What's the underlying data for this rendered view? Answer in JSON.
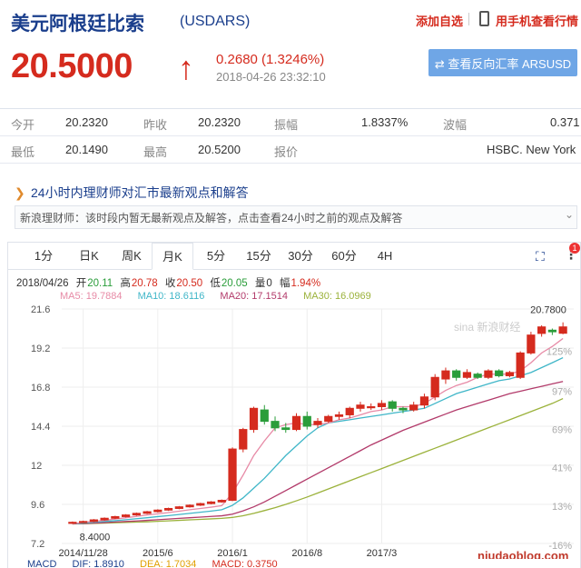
{
  "header": {
    "title": "美元阿根廷比索",
    "code": "(USDARS)",
    "add_favorite": "添加自选",
    "phone_view": "用手机查看行情"
  },
  "quote": {
    "price": "20.5000",
    "arrow": "↑",
    "change": "0.2680 (1.3246%)",
    "timestamp": "2018-04-26 23:32:10",
    "inverse_button": "⇄ 查看反向汇率 ARSUSD"
  },
  "stats": [
    [
      {
        "label": "今开",
        "value": "20.2320"
      },
      {
        "label": "昨收",
        "value": "20.2320"
      },
      {
        "label": "振幅",
        "value": "1.8337%"
      },
      {
        "label": "波幅",
        "value": "0.371"
      }
    ],
    [
      {
        "label": "最低",
        "value": "20.1490"
      },
      {
        "label": "最高",
        "value": "20.5200"
      },
      {
        "label": "报价",
        "value": ""
      },
      {
        "label": "",
        "value": "HSBC. New York"
      }
    ]
  ],
  "expert": {
    "title": "24小时内理财师对汇市最新观点和解答",
    "text": "新浪理财师：该时段内暂无最新观点及解答，点击查看24小时之前的观点及解答"
  },
  "tabs": [
    "1分",
    "日K",
    "周K",
    "月K",
    "5分",
    "15分",
    "30分",
    "60分",
    "4H"
  ],
  "active_tab": "月K",
  "badge": "1",
  "ohlc": {
    "date": "2018/04/26",
    "open_label": "开",
    "open": "20.11",
    "high_label": "高",
    "high": "20.78",
    "close_label": "收",
    "close": "20.50",
    "low_label": "低",
    "low": "20.05",
    "vol_label": "量",
    "vol": "0",
    "amp_label": "幅",
    "amp": "1.94%"
  },
  "ma": [
    {
      "label": "MA5: 19.7884",
      "color": "#e78aa6"
    },
    {
      "label": "MA10: 18.6116",
      "color": "#3fb6c8"
    },
    {
      "label": "MA20: 17.1514",
      "color": "#b23a6a"
    },
    {
      "label": "MA30: 16.0969",
      "color": "#9bb23b"
    }
  ],
  "macd": [
    {
      "label": "MACD",
      "color": "#1a3e8c"
    },
    {
      "label": "DIF: 1.8910",
      "color": "#1a3e8c"
    },
    {
      "label": "DEA: 1.7034",
      "color": "#e0a000"
    },
    {
      "label": "MACD: 0.3750",
      "color": "#d52b1e"
    }
  ],
  "watermark": "sina 新浪财经",
  "site_watermark": "niudaoblog.com",
  "colors": {
    "up": "#d52b1e",
    "down": "#2a9d3a",
    "accent": "#1a3e8c"
  },
  "chart_data": {
    "type": "candlestick",
    "y_ticks": [
      "21.6",
      "19.2",
      "16.8",
      "14.4",
      "12",
      "9.6",
      "7.2"
    ],
    "y_tick_values": [
      21.6,
      19.2,
      16.8,
      14.4,
      12,
      9.6,
      7.2
    ],
    "pct_ticks": [
      {
        "label": "125%",
        "value": 19.0
      },
      {
        "label": "97%",
        "value": 16.55
      },
      {
        "label": "69%",
        "value": 14.2
      },
      {
        "label": "41%",
        "value": 11.85
      },
      {
        "label": "13%",
        "value": 9.5
      },
      {
        "label": "-16%",
        "value": 7.1
      }
    ],
    "x_ticks": [
      "2014/11/28",
      "2015/6",
      "2016/1",
      "2016/8",
      "2017/3"
    ],
    "x_tick_index": [
      1,
      8,
      15,
      22,
      29
    ],
    "ylim": [
      7.2,
      21.6
    ],
    "max_label": "20.7800",
    "min_label": "8.4000",
    "candles": [
      [
        8.45,
        8.5,
        8.4,
        8.55
      ],
      [
        8.5,
        8.55,
        8.45,
        8.6
      ],
      [
        8.55,
        8.65,
        8.5,
        8.7
      ],
      [
        8.65,
        8.75,
        8.6,
        8.8
      ],
      [
        8.75,
        8.85,
        8.7,
        8.9
      ],
      [
        8.85,
        8.95,
        8.8,
        9.0
      ],
      [
        8.95,
        9.05,
        8.9,
        9.1
      ],
      [
        9.05,
        9.15,
        9.0,
        9.2
      ],
      [
        9.15,
        9.25,
        9.1,
        9.3
      ],
      [
        9.25,
        9.35,
        9.2,
        9.4
      ],
      [
        9.35,
        9.45,
        9.3,
        9.5
      ],
      [
        9.45,
        9.55,
        9.4,
        9.6
      ],
      [
        9.55,
        9.65,
        9.5,
        9.7
      ],
      [
        9.65,
        9.75,
        9.6,
        9.8
      ],
      [
        9.75,
        9.85,
        9.7,
        9.9
      ],
      [
        9.85,
        13.0,
        9.8,
        13.1
      ],
      [
        13.0,
        14.2,
        12.8,
        14.3
      ],
      [
        14.2,
        15.5,
        14.0,
        15.6
      ],
      [
        15.4,
        14.7,
        14.5,
        15.7
      ],
      [
        14.7,
        14.3,
        14.1,
        15.0
      ],
      [
        14.3,
        14.2,
        14.0,
        14.6
      ],
      [
        14.2,
        15.0,
        14.1,
        15.2
      ],
      [
        15.0,
        14.4,
        14.2,
        15.3
      ],
      [
        14.5,
        14.7,
        14.3,
        14.9
      ],
      [
        14.7,
        15.0,
        14.6,
        15.1
      ],
      [
        15.0,
        15.1,
        14.8,
        15.3
      ],
      [
        15.1,
        15.5,
        14.9,
        15.6
      ],
      [
        15.5,
        15.7,
        15.3,
        15.9
      ],
      [
        15.6,
        15.6,
        15.4,
        15.8
      ],
      [
        15.6,
        15.8,
        15.4,
        16.0
      ],
      [
        15.9,
        15.5,
        15.3,
        16.0
      ],
      [
        15.5,
        15.4,
        15.2,
        15.6
      ],
      [
        15.4,
        15.7,
        15.3,
        15.9
      ],
      [
        15.7,
        16.2,
        15.5,
        16.4
      ],
      [
        16.2,
        17.4,
        16.0,
        17.6
      ],
      [
        17.3,
        17.8,
        17.0,
        18.0
      ],
      [
        17.8,
        17.4,
        17.2,
        17.9
      ],
      [
        17.4,
        17.7,
        17.3,
        17.9
      ],
      [
        17.6,
        17.4,
        17.3,
        17.7
      ],
      [
        17.4,
        17.8,
        17.3,
        17.9
      ],
      [
        17.8,
        17.5,
        17.4,
        17.9
      ],
      [
        17.5,
        17.7,
        17.4,
        17.8
      ],
      [
        17.4,
        18.9,
        17.3,
        19.0
      ],
      [
        18.9,
        20.0,
        18.8,
        20.2
      ],
      [
        20.1,
        20.5,
        19.9,
        20.6
      ],
      [
        20.3,
        20.2,
        20.0,
        20.4
      ],
      [
        20.11,
        20.5,
        20.05,
        20.78
      ]
    ],
    "ma5": [
      8.4,
      8.5,
      8.55,
      8.62,
      8.7,
      8.78,
      8.86,
      8.95,
      9.02,
      9.1,
      9.18,
      9.27,
      9.35,
      9.43,
      9.52,
      10.3,
      11.4,
      12.6,
      13.5,
      14.3,
      14.5,
      14.6,
      14.5,
      14.5,
      14.6,
      14.8,
      14.9,
      15.1,
      15.3,
      15.4,
      15.6,
      15.6,
      15.6,
      15.8,
      16.2,
      16.6,
      16.9,
      17.1,
      17.4,
      17.6,
      17.6,
      17.6,
      17.8,
      18.3,
      18.9,
      19.3,
      19.79
    ],
    "ma10": [
      8.4,
      8.45,
      8.5,
      8.55,
      8.6,
      8.66,
      8.72,
      8.78,
      8.85,
      8.91,
      8.98,
      9.05,
      9.12,
      9.19,
      9.27,
      9.54,
      10.0,
      10.6,
      11.2,
      11.9,
      12.6,
      13.2,
      13.8,
      14.3,
      14.6,
      14.7,
      14.8,
      14.9,
      15.0,
      15.1,
      15.2,
      15.3,
      15.4,
      15.5,
      15.8,
      16.1,
      16.4,
      16.6,
      16.8,
      17.0,
      17.2,
      17.3,
      17.5,
      17.7,
      18.0,
      18.3,
      18.61
    ],
    "ma20": [
      8.4,
      8.42,
      8.45,
      8.48,
      8.52,
      8.55,
      8.58,
      8.62,
      8.66,
      8.7,
      8.74,
      8.78,
      8.82,
      8.86,
      8.9,
      9.0,
      9.2,
      9.45,
      9.75,
      10.1,
      10.45,
      10.8,
      11.15,
      11.5,
      11.85,
      12.2,
      12.55,
      12.9,
      13.25,
      13.55,
      13.85,
      14.15,
      14.4,
      14.65,
      14.9,
      15.15,
      15.4,
      15.6,
      15.8,
      16.0,
      16.2,
      16.4,
      16.55,
      16.7,
      16.85,
      17.0,
      17.15
    ],
    "ma30": [
      8.4,
      8.41,
      8.43,
      8.45,
      8.47,
      8.49,
      8.51,
      8.53,
      8.56,
      8.59,
      8.62,
      8.65,
      8.68,
      8.71,
      8.74,
      8.8,
      8.9,
      9.05,
      9.22,
      9.4,
      9.6,
      9.82,
      10.05,
      10.3,
      10.55,
      10.8,
      11.05,
      11.3,
      11.55,
      11.8,
      12.05,
      12.3,
      12.55,
      12.8,
      13.05,
      13.3,
      13.55,
      13.8,
      14.05,
      14.3,
      14.55,
      14.8,
      15.05,
      15.3,
      15.55,
      15.8,
      16.1
    ]
  }
}
